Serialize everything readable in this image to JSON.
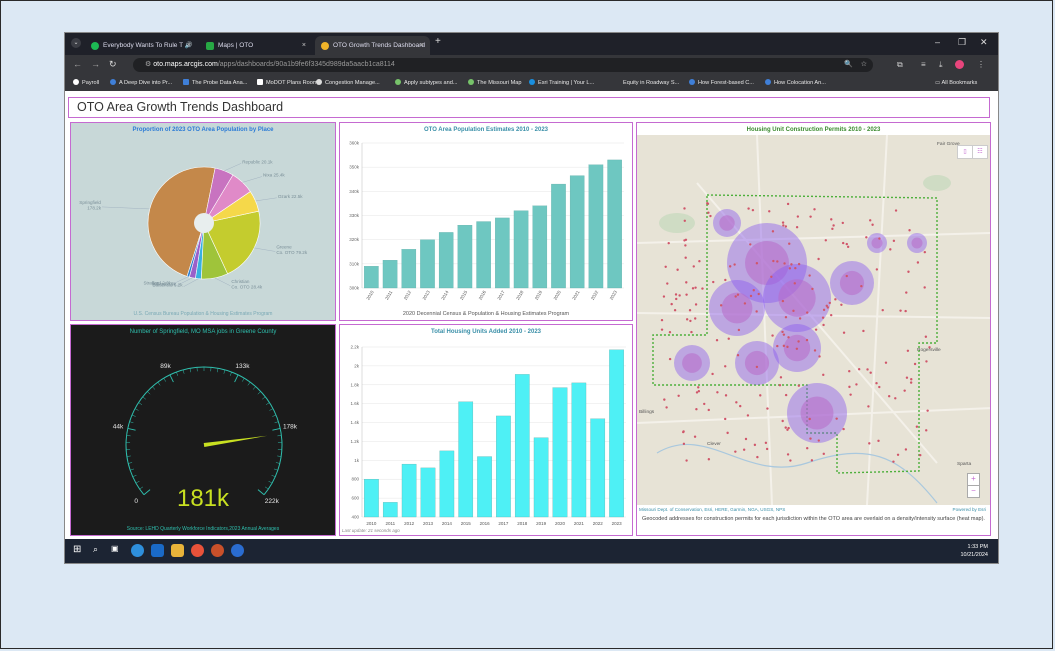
{
  "browser": {
    "tabs": [
      {
        "label": "Everybody Wants To Rule T",
        "icon": "spotify-icon",
        "color": "#1db954"
      },
      {
        "label": "Maps | OTO",
        "icon": "maps-icon",
        "color": "#27a844"
      },
      {
        "label": "OTO Growth Trends Dashboard",
        "icon": "dashboard-icon",
        "color": "#f0b429"
      }
    ],
    "url_domain": "oto.maps.arcgis.com",
    "url_path": "/apps/dashboards/90a1b9fe6f3345d989da5aacb1ca8114",
    "bookmarks": [
      "Payroll",
      "A Deep Dive into Pr...",
      "The Probe Data Ana...",
      "MoDOT Plans Room",
      "Congestion Manage...",
      "Apply subtypes and...",
      "The Missouri Map",
      "Esri Training | Your L...",
      "Equity in Roadway S...",
      "How Forest-based C...",
      "How Colocation An..."
    ],
    "all_bookmarks": "All Bookmarks"
  },
  "dashboard": {
    "title": "OTO Area Growth Trends Dashboard"
  },
  "pie_panel": {
    "title": "Proportion of 2023 OTO Area Population by Place",
    "footer": "U.S. Census Bureau Population & Housing Estimates Program",
    "labels": {
      "springfield": "Springfield\n178.2k",
      "strafford": "Strafford 2.6k",
      "willard": "Willard 6.5k",
      "battlefield": "Battlefield 6.2k",
      "christian": "Christian\nCo. OTO 28.4k",
      "greene": "Greene\nCo. OTO 79.2k",
      "ozark": "Ozark 22.5k",
      "nixa": "Nixa 25.4k",
      "republic": "Republic 20.1k"
    }
  },
  "gauge_panel": {
    "title": "Number of Springfield, MO MSA jobs in Greene County",
    "value": "181k",
    "value_number": 181,
    "min_number": 0,
    "max_number": 222,
    "ticks": [
      "0",
      "44k",
      "89k",
      "133k",
      "178k",
      "222k"
    ],
    "footer": "Source: LEHD Quarterly Workforce Indicators,2023 Annual Averages",
    "colors": {
      "background": "#1b1b1b",
      "accent": "#2fbfae",
      "needle": "#c8e021"
    }
  },
  "chart_data": [
    {
      "type": "bar",
      "title": "OTO Area Population Estimates 2010 - 2023",
      "xlabel": "2020 Decennial Census & Population & Housing Estimates Program",
      "ylabel": "",
      "categories": [
        "2010",
        "2011",
        "2012",
        "2013",
        "2014",
        "2015",
        "2016",
        "2017",
        "2018",
        "2019",
        "2020",
        "2021",
        "2022",
        "2023"
      ],
      "values": [
        309000,
        311500,
        316000,
        320000,
        323000,
        326000,
        327500,
        329000,
        332000,
        334000,
        343000,
        346500,
        351000,
        353000
      ],
      "ylim": [
        300000,
        360000
      ],
      "yticks": [
        "300k",
        "310k",
        "320k",
        "330k",
        "340k",
        "350k",
        "360k"
      ],
      "color": "#6ec7c1"
    },
    {
      "type": "bar",
      "title": "Total Housing Units Added 2010 - 2023",
      "xlabel": "",
      "ylabel": "",
      "categories": [
        "2010",
        "2011",
        "2012",
        "2013",
        "2014",
        "2015",
        "2016",
        "2017",
        "2018",
        "2019",
        "2020",
        "2021",
        "2022",
        "2023"
      ],
      "values": [
        800,
        555,
        960,
        920,
        1100,
        1620,
        1040,
        1470,
        1910,
        1240,
        1770,
        1820,
        1440,
        2170
      ],
      "ylim": [
        400,
        2200
      ],
      "yticks": [
        "400",
        "600",
        "800",
        "1k",
        "1.2k",
        "1.4k",
        "1.6k",
        "1.8k",
        "2k",
        "2.2k"
      ],
      "footer": "Last update: 21 seconds ago",
      "color": "#4ef0f5"
    },
    {
      "type": "pie",
      "title": "Proportion of 2023 OTO Area Population by Place",
      "categories": [
        "Springfield",
        "Strafford",
        "Willard",
        "Battlefield",
        "Christian Co. OTO",
        "Greene Co. OTO",
        "Ozark",
        "Nixa",
        "Republic"
      ],
      "values": [
        178.2,
        2.6,
        6.5,
        6.2,
        28.4,
        79.2,
        22.5,
        25.4,
        20.1
      ],
      "colors": [
        "#c4884a",
        "#2d7fd1",
        "#9a5fc9",
        "#38b0e0",
        "#9fc43a",
        "#c4cc2e",
        "#f5d84a",
        "#e08ac8",
        "#c873c0"
      ]
    }
  ],
  "map_panel": {
    "title": "Housing Unit Construction Permits 2010 - 2023",
    "attribution": "Missouri Dept. of Conservation, Esri, HERE, Garmin, NGA, USGS, NPS",
    "powered_by": "Powered by Esri",
    "caption": "Geocoded addresses for construction permits for each jurisdiction within the OTO area are overlaid on a density/intensity surface (heat map).",
    "places": [
      "Fair Grove",
      "Rogersville",
      "Clever",
      "Billings",
      "Sparta"
    ],
    "zoom_in": "+",
    "zoom_out": "−"
  },
  "taskbar": {
    "time": "1:33 PM",
    "date": "10/21/2024"
  }
}
